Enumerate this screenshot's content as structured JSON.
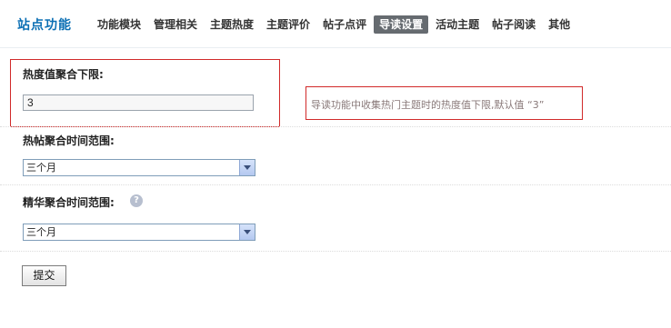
{
  "header": {
    "site_title": "站点功能",
    "tabs": [
      {
        "label": "功能模块",
        "active": false
      },
      {
        "label": "管理相关",
        "active": false
      },
      {
        "label": "主题热度",
        "active": false
      },
      {
        "label": "主题评价",
        "active": false
      },
      {
        "label": "帖子点评",
        "active": false
      },
      {
        "label": "导读设置",
        "active": true
      },
      {
        "label": "活动主题",
        "active": false
      },
      {
        "label": "帖子阅读",
        "active": false
      },
      {
        "label": "其他",
        "active": false
      }
    ]
  },
  "form": {
    "heat_lower_limit": {
      "label": "热度值聚合下限:",
      "value": "3",
      "hint": "导读功能中收集热门主题时的热度值下限,默认值 “3”"
    },
    "hot_post_range": {
      "label": "热帖聚合时间范围:",
      "selected": "三个月"
    },
    "digest_range": {
      "label": "精华聚合时间范围:",
      "selected": "三个月",
      "help_icon": "help-bubble-icon"
    },
    "submit_label": "提交"
  },
  "colors": {
    "accent": "#0b6fb4",
    "active_tab": "#666b70",
    "highlight_border": "#d12a2a"
  }
}
